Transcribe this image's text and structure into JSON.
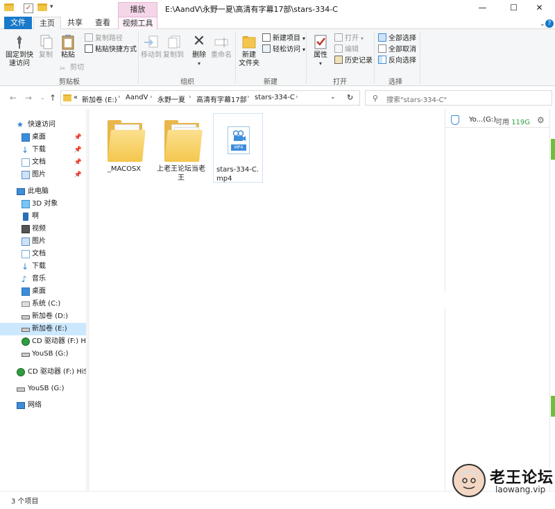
{
  "window": {
    "title_path": "E:\\AandV\\永野一夏\\高清有字幕17部\\stars-334-C",
    "context_tab": "播放",
    "controls": {
      "minimize": "—",
      "maximize": "☐",
      "close": "✕"
    }
  },
  "tabs": [
    "文件",
    "主页",
    "共享",
    "查看",
    "视频工具"
  ],
  "ribbon": {
    "clipboard": {
      "label": "剪贴板",
      "pin": "固定到快\n速访问",
      "copy": "复制",
      "paste": "粘贴",
      "copy_path": "复制路径",
      "paste_shortcut": "粘贴快捷方式",
      "cut": "剪切"
    },
    "organize": {
      "label": "组织",
      "move_to": "移动到",
      "copy_to": "复制到",
      "delete": "删除",
      "rename": "重命名"
    },
    "new": {
      "label": "新建",
      "new_folder": "新建\n文件夹",
      "new_item": "新建项目",
      "easy_access": "轻松访问"
    },
    "open": {
      "label": "打开",
      "properties": "属性",
      "open": "打开",
      "edit": "编辑",
      "history": "历史记录"
    },
    "select": {
      "label": "选择",
      "select_all": "全部选择",
      "select_none": "全部取消",
      "invert": "反向选择"
    },
    "help": "?"
  },
  "address": {
    "prefix": "«",
    "crumbs": [
      "新加卷 (E:)",
      "AandV",
      "永野一夏",
      "高清有字幕17部",
      "stars-334-C"
    ],
    "search_placeholder": "搜索\"stars-334-C\""
  },
  "sidebar": {
    "quick_access": "快速访问",
    "quick_items": [
      "桌面",
      "下载",
      "文档",
      "图片"
    ],
    "this_pc": "此电脑",
    "pc_items": [
      "3D 对象",
      "啊",
      "视频",
      "图片",
      "文档",
      "下载",
      "音乐",
      "桌面",
      "系统 (C:)",
      "新加卷 (D:)",
      "新加卷 (E:)",
      "CD 驱动器 (F:) HiSui",
      "YouSB (G:)"
    ],
    "extra_items": [
      "CD 驱动器 (F:) HiSui",
      "YouSB (G:)",
      "网络"
    ]
  },
  "files": [
    {
      "name": "_MACOSX",
      "type": "folder"
    },
    {
      "name": "上老王论坛当老王",
      "type": "folder"
    },
    {
      "name": "stars-334-C.mp4",
      "type": "mp4",
      "tag": "MP4"
    }
  ],
  "details": {
    "drive_name": "Yo...(G:)",
    "free_label": "可用",
    "free_value": "119G"
  },
  "status": {
    "count": "3 个项目"
  },
  "watermark": {
    "title": "老王论坛",
    "url": "laowang.vip"
  },
  "colors": {
    "accent": "#1979ca",
    "selection": "#cce8ff",
    "folder": "#f4c64d",
    "context_tab": "#f5d6e8"
  }
}
